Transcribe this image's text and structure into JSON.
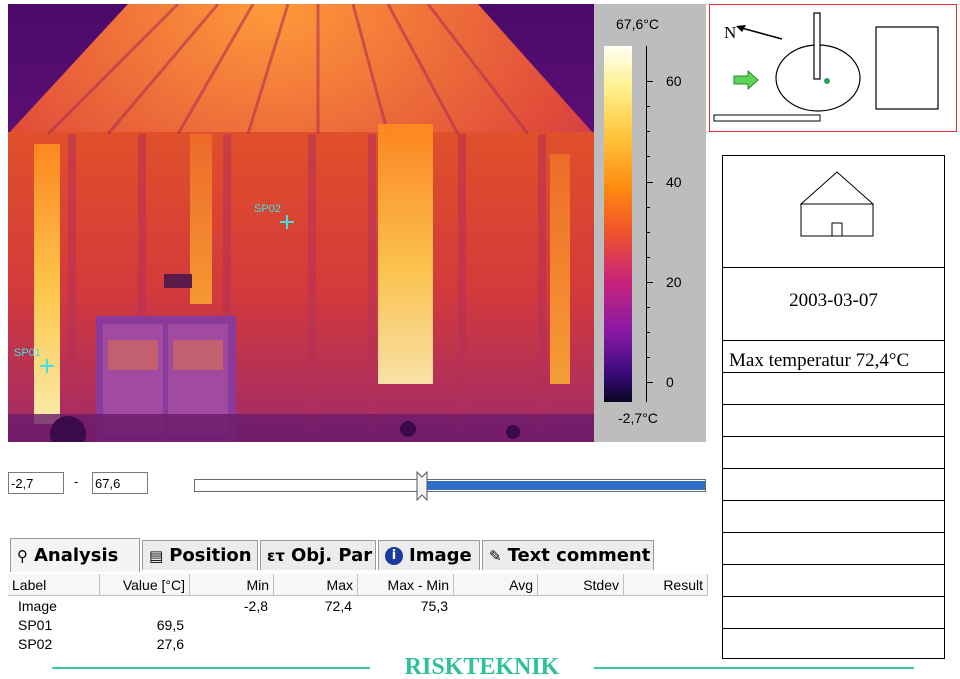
{
  "thermal_image": {
    "spots": [
      {
        "label": "SP02"
      },
      {
        "label": "SP01"
      }
    ]
  },
  "scale": {
    "max_label": "67,6°C",
    "min_label": "-2,7°C",
    "ticks": [
      "60",
      "40",
      "20",
      "0"
    ]
  },
  "range": {
    "min_value": "-2,7",
    "separator": "-",
    "max_value": "67,6"
  },
  "tabs": [
    {
      "label": "Analysis",
      "icon": "analysis-icon",
      "active": true
    },
    {
      "label": "Position",
      "icon": "ruler-icon",
      "active": false
    },
    {
      "label": "Obj. Par",
      "icon": "object-parameters-icon",
      "active": false
    },
    {
      "label": "Image",
      "icon": "info-icon",
      "active": false
    },
    {
      "label": "Text comment",
      "icon": "text-comment-icon",
      "active": false
    }
  ],
  "analysis_table": {
    "columns": [
      "Label",
      "Value [°C]",
      "Min",
      "Max",
      "Max - Min",
      "Avg",
      "Stdev",
      "Result"
    ],
    "rows": [
      {
        "label": "Image",
        "value": "",
        "min": "-2,8",
        "max": "72,4",
        "maxmin": "75,3",
        "avg": "",
        "stdev": "",
        "result": ""
      },
      {
        "label": "SP01",
        "value": "69,5",
        "min": "",
        "max": "",
        "maxmin": "",
        "avg": "",
        "stdev": "",
        "result": ""
      },
      {
        "label": "SP02",
        "value": "27,6",
        "min": "",
        "max": "",
        "maxmin": "",
        "avg": "",
        "stdev": "",
        "result": ""
      }
    ]
  },
  "site_map": {
    "north_label": "N"
  },
  "info_panel": {
    "date": "2003-03-07",
    "max_temp": "Max temperatur 72,4°C"
  },
  "footer": {
    "brand": "RISKTEKNIK"
  },
  "colors": {
    "accent_footer": "#3ec9a0",
    "spot_marker": "#3fe0e6",
    "slider_fill": "#2f6ec8",
    "site_map_border": "#e03030"
  }
}
